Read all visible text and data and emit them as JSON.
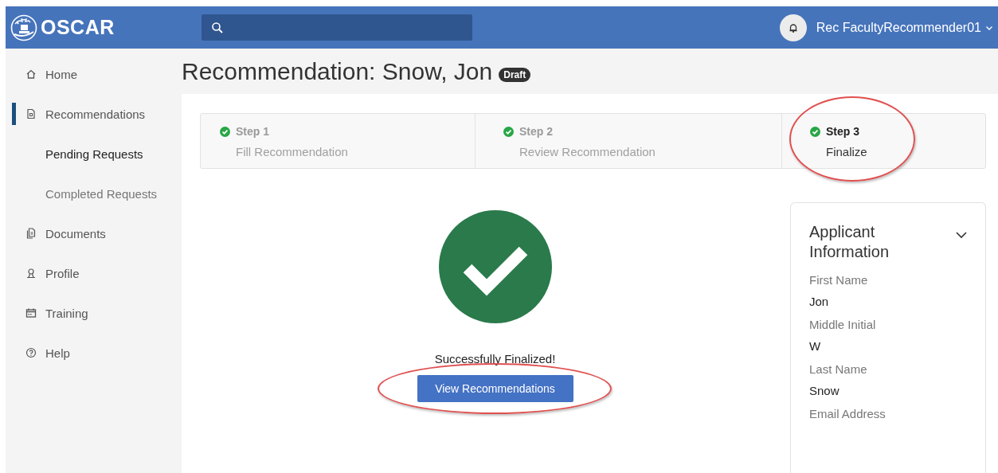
{
  "header": {
    "logo": "OSCAR",
    "user": "Rec FacultyRecommender01"
  },
  "sidebar": {
    "items": [
      {
        "label": "Home",
        "selected": false
      },
      {
        "label": "Recommendations",
        "selected": true,
        "children": [
          {
            "label": "Pending Requests",
            "selected": true
          },
          {
            "label": "Completed Requests",
            "selected": false
          }
        ]
      },
      {
        "label": "Documents",
        "selected": false
      },
      {
        "label": "Profile",
        "selected": false
      },
      {
        "label": "Training",
        "selected": false
      },
      {
        "label": "Help",
        "selected": false
      }
    ]
  },
  "page": {
    "title": "Recommendation: Snow, Jon",
    "badge": "Draft"
  },
  "steps": [
    {
      "label": "Step 1",
      "description": "Fill Recommendation",
      "done": true,
      "selected": false,
      "circled": false
    },
    {
      "label": "Step 2",
      "description": "Review Recommendation",
      "done": true,
      "selected": false,
      "circled": false
    },
    {
      "label": "Step 3",
      "description": "Finalize",
      "done": true,
      "selected": true,
      "circled": true
    }
  ],
  "result": {
    "success": true,
    "message": "Successfully Finalized!",
    "button": "View Recommendations",
    "button_circled": true
  },
  "applicant": {
    "title": "Applicant Information",
    "expanded": true,
    "fields": [
      {
        "label": "First Name",
        "value": "Jon"
      },
      {
        "label": "Middle Initial",
        "value": "W"
      },
      {
        "label": "Last Name",
        "value": "Snow"
      },
      {
        "label": "Email Address"
      }
    ]
  }
}
